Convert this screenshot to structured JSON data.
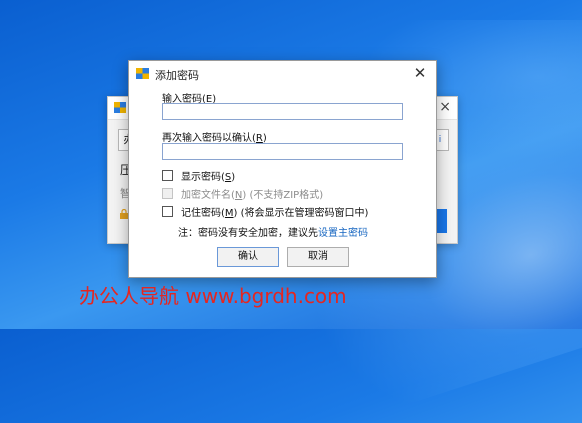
{
  "background_window": {
    "field_char": "办",
    "label_a": "压",
    "label_b": "智",
    "right_field_char": "i"
  },
  "dialog": {
    "title": "添加密码",
    "password_label_prefix": "输入密码(",
    "password_label_key": "E",
    "password_label_suffix": ")",
    "password_value": "",
    "confirm_label_prefix": "再次输入密码以确认(",
    "confirm_label_key": "R",
    "confirm_label_suffix": ")",
    "confirm_value": "",
    "options": [
      {
        "prefix": "显示密码(",
        "key": "S",
        "suffix": ")",
        "checked": false,
        "disabled": false
      },
      {
        "prefix": "加密文件名(",
        "key": "N",
        "suffix": ") (不支持ZIP格式)",
        "checked": false,
        "disabled": true
      },
      {
        "prefix": "记住密码(",
        "key": "M",
        "suffix": ") (将会显示在管理密码窗口中)",
        "checked": false,
        "disabled": false
      }
    ],
    "note_text": "注：密码没有安全加密，建议先",
    "note_link": "设置主密码",
    "ok_label": "确认",
    "cancel_label": "取消"
  },
  "watermark": "办公人导航 www.bgrdh.com",
  "colors": {
    "desktop_accent": "#1b7ae6",
    "link": "#1565c0",
    "watermark": "#e52620"
  }
}
